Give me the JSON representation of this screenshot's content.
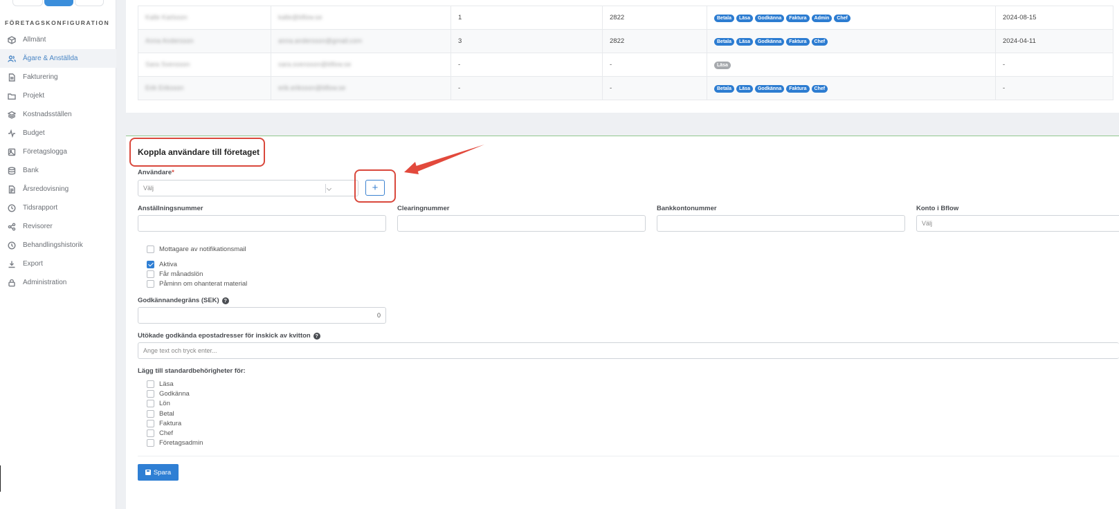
{
  "sidebar": {
    "heading": "FÖRETAGSKONFIGURATION",
    "items": [
      {
        "label": "Allmänt",
        "icon": "cube-icon"
      },
      {
        "label": "Ägare & Anställda",
        "icon": "users-icon",
        "active": true
      },
      {
        "label": "Fakturering",
        "icon": "document-icon"
      },
      {
        "label": "Projekt",
        "icon": "folder-icon"
      },
      {
        "label": "Kostnadsställen",
        "icon": "layers-icon"
      },
      {
        "label": "Budget",
        "icon": "activity-icon"
      },
      {
        "label": "Företagslogga",
        "icon": "image-icon"
      },
      {
        "label": "Bank",
        "icon": "database-icon"
      },
      {
        "label": "Årsredovisning",
        "icon": "report-icon"
      },
      {
        "label": "Tidsrapport",
        "icon": "clock-icon"
      },
      {
        "label": "Revisorer",
        "icon": "share-icon"
      },
      {
        "label": "Behandlingshistorik",
        "icon": "history-icon"
      },
      {
        "label": "Export",
        "icon": "download-icon"
      },
      {
        "label": "Administration",
        "icon": "lock-icon"
      }
    ]
  },
  "table": {
    "rows": [
      {
        "name": "Kalle Karlsson",
        "email": "kalle@bflow.se",
        "number": "1",
        "clearing": "2822",
        "roles": [
          "Betala",
          "Läsa",
          "Godkänna",
          "Faktura",
          "Admin",
          "Chef"
        ],
        "date": "2024-08-15"
      },
      {
        "name": "Anna Andersson",
        "email": "anna.andersson@gmail.com",
        "number": "3",
        "clearing": "2822",
        "roles": [
          "Betala",
          "Läsa",
          "Godkänna",
          "Faktura",
          "Chef"
        ],
        "date": "2024-04-11"
      },
      {
        "name": "Sara Svensson",
        "email": "sara.svensson@bflow.se",
        "number": "-",
        "clearing": "-",
        "roles": [
          "Läsa"
        ],
        "date": "-"
      },
      {
        "name": "Erik Eriksson",
        "email": "erik.eriksson@bflow.se",
        "number": "-",
        "clearing": "-",
        "roles": [
          "Betala",
          "Läsa",
          "Godkänna",
          "Faktura",
          "Chef"
        ],
        "date": "-"
      }
    ]
  },
  "form": {
    "title": "Koppla användare till företaget",
    "user_label": "Användare",
    "required_mark": "*",
    "user_placeholder": "Välj",
    "add_button": "+",
    "employee_number_label": "Anställningsnummer",
    "clearing_label": "Clearingnummer",
    "bank_account_label": "Bankkontonummer",
    "bflow_account_label": "Konto i Bflow",
    "bflow_account_placeholder": "Välj",
    "checkboxes": [
      {
        "label": "Mottagare av notifikationsmail",
        "checked": false
      },
      {
        "label": "Aktiva",
        "checked": true
      },
      {
        "label": "Får månadslön",
        "checked": false
      },
      {
        "label": "Påminn om ohanterat material",
        "checked": false
      }
    ],
    "approval_limit_label": "Godkännandegräns (SEK)",
    "approval_limit_value": "0",
    "help_symbol": "?",
    "extended_emails_label": "Utökade godkända epostadresser för inskick av kvitton",
    "extended_emails_placeholder": "Ange text och tryck enter...",
    "permissions_label": "Lägg till standardbehörigheter för:",
    "permissions": [
      "Läsa",
      "Godkänna",
      "Lön",
      "Betal",
      "Faktura",
      "Chef",
      "Företagsadmin"
    ],
    "save_button": "Spara"
  },
  "colors": {
    "accent": "#2f7fd4",
    "highlight": "#d9473b",
    "badge": "#2c7cd1",
    "badge_muted": "#a6a9ad"
  }
}
